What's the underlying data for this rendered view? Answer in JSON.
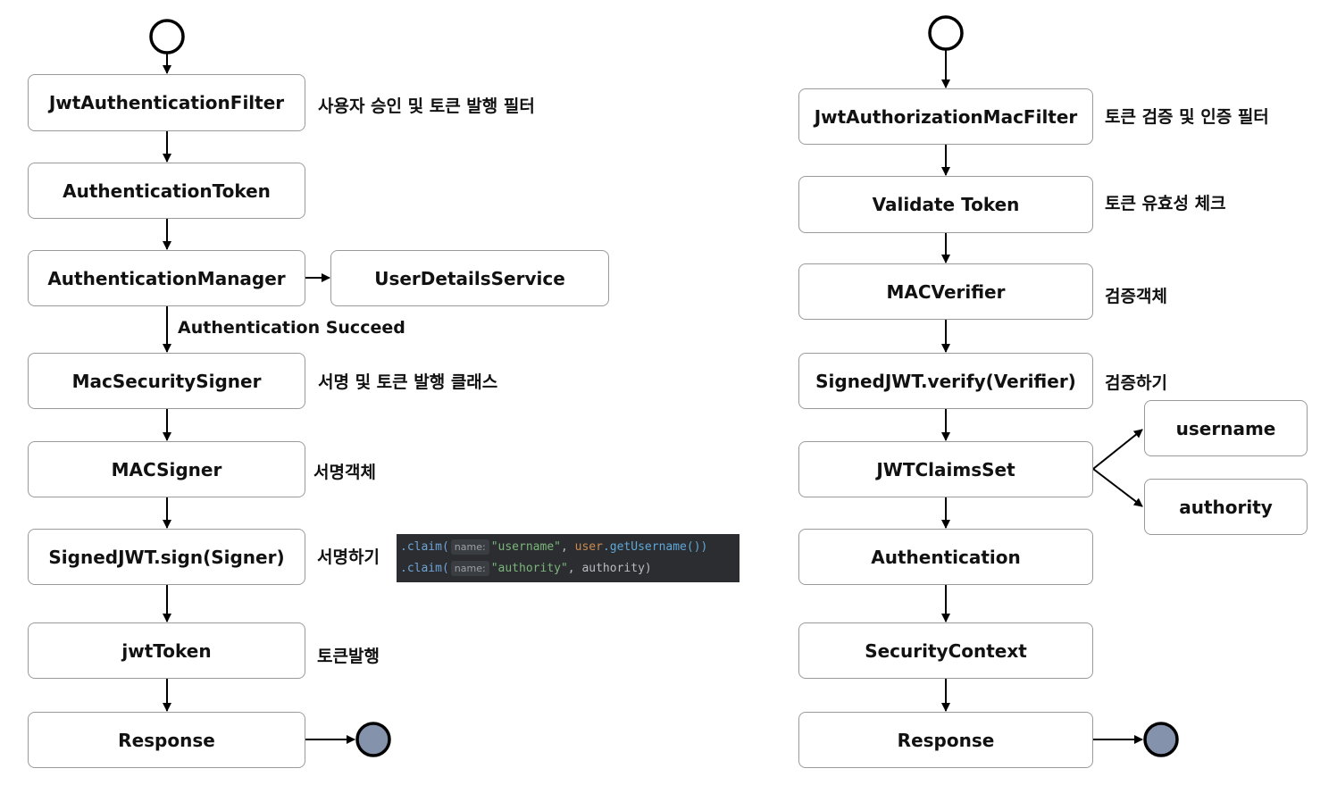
{
  "left_flow": {
    "steps": [
      {
        "label": "JwtAuthenticationFilter",
        "note": "사용자 승인 및 토큰 발행 필터"
      },
      {
        "label": "AuthenticationToken",
        "note": ""
      },
      {
        "label": "AuthenticationManager",
        "note": ""
      },
      {
        "label": "MacSecuritySigner",
        "note": "서명 및 토큰 발행 클래스"
      },
      {
        "label": "MACSigner",
        "note": "서명객체"
      },
      {
        "label": "SignedJWT.sign(Signer)",
        "note": "서명하기"
      },
      {
        "label": "jwtToken",
        "note": "토큰발행"
      },
      {
        "label": "Response",
        "note": ""
      }
    ],
    "side_box": "UserDetailsService",
    "edge_label": "Authentication Succeed"
  },
  "right_flow": {
    "steps": [
      {
        "label": "JwtAuthorizationMacFilter",
        "note": "토큰 검증 및 인증 필터"
      },
      {
        "label": "Validate Token",
        "note": "토큰 유효성 체크"
      },
      {
        "label": "MACVerifier",
        "note": "검증객체"
      },
      {
        "label": "SignedJWT.verify(Verifier)",
        "note": "검증하기"
      },
      {
        "label": "JWTClaimsSet",
        "note": ""
      },
      {
        "label": "Authentication",
        "note": ""
      },
      {
        "label": "SecurityContext",
        "note": ""
      },
      {
        "label": "Response",
        "note": ""
      }
    ],
    "claims": [
      "username",
      "authority"
    ]
  },
  "code_snippet": {
    "line1": {
      "method": ".claim(",
      "hint": "name:",
      "key": "\"username\"",
      "sep": ", ",
      "var": "user",
      "call": ".getUsername())"
    },
    "line2": {
      "method": ".claim(",
      "hint": "name:",
      "key": "\"authority\"",
      "sep": ", ",
      "rest": "authority)"
    }
  },
  "colors": {
    "end_node_fill": "#8492ab",
    "box_border": "#9a9a9a",
    "code_bg": "#2b2d30"
  }
}
